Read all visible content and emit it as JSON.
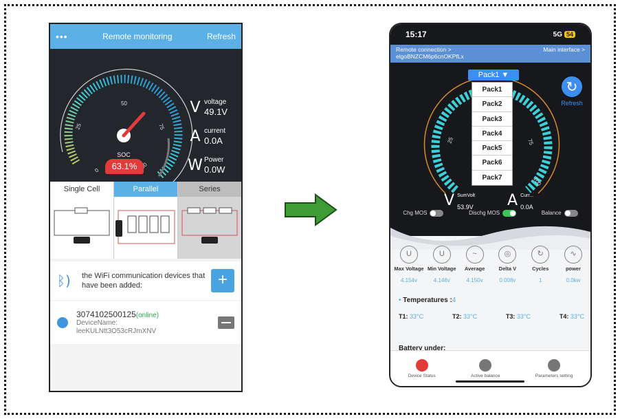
{
  "left_app": {
    "header": {
      "menu_icon": "more-dots-icon",
      "title": "Remote monitoring",
      "refresh": "Refresh"
    },
    "gauge": {
      "label": "SOC",
      "ticks": [
        "0",
        "25",
        "50",
        "75",
        "100"
      ],
      "value_text": "63.1%",
      "level_percent": 63.1
    },
    "meters": [
      {
        "icon": "voltage-icon",
        "label": "voltage",
        "value": "49.1V"
      },
      {
        "icon": "current-icon",
        "label": "current",
        "value": "0.0A"
      },
      {
        "icon": "power-icon",
        "label": "Power",
        "value": "0.0W"
      }
    ],
    "tabs": [
      "Single Cell",
      "Parallel",
      "Series"
    ],
    "wifi_text": "the WiFi communication devices that have been added:",
    "device": {
      "id": "3074102500125",
      "status": "(online)",
      "name_label": "DeviceName:",
      "name_value": "leeKULNtt3O53cRJmXNV"
    }
  },
  "right_app": {
    "status_bar": {
      "time": "15:17",
      "network": "5G",
      "battery": "54"
    },
    "connection": {
      "left_line1": "Remote connection >",
      "left_line2": "elgoBNZCM6p6cnOKPfLx",
      "right": "Main interface >"
    },
    "pack_select": "Pack1",
    "pack_options": [
      "Pack1",
      "Pack2",
      "Pack3",
      "Pack4",
      "Pack5",
      "Pack6",
      "Pack7"
    ],
    "refresh": "Refresh",
    "gauge_ticks": [
      "25",
      "75",
      "100"
    ],
    "meters": [
      {
        "label": "SumVolt",
        "value": "53.9V"
      },
      {
        "label": "Curr...",
        "value": "0.0A"
      }
    ],
    "toggles": [
      {
        "label": "Chg MOS",
        "on": false
      },
      {
        "label": "Dischg MOS",
        "on": true
      },
      {
        "label": "Balance",
        "on": false
      }
    ],
    "stats": [
      {
        "label": "Max Voltage",
        "value": "4.154v"
      },
      {
        "label": "Min Voltage",
        "value": "4.146v"
      },
      {
        "label": "Average",
        "value": "4.150v"
      },
      {
        "label": "Delta V",
        "value": "0.008v"
      },
      {
        "label": "Cycles",
        "value": "1"
      },
      {
        "label": "power",
        "value": "0.0kw"
      }
    ],
    "temperatures": {
      "title": "Temperatures :",
      "count": "4",
      "items": [
        {
          "label": "T1:",
          "value": "33°C"
        },
        {
          "label": "T2:",
          "value": "33°C"
        },
        {
          "label": "T3:",
          "value": "33°C"
        },
        {
          "label": "T4:",
          "value": "33°C"
        }
      ]
    },
    "battery_heading": "Battery under:",
    "bottom_nav": [
      "Device Status",
      "Active balance",
      "Parameters setting"
    ]
  },
  "colors": {
    "blue": "#5bb0e6",
    "red": "#e23b3b",
    "cyan": "#3ecfd9",
    "green": "#3cc45a",
    "arrow_green": "#3f9b35"
  }
}
